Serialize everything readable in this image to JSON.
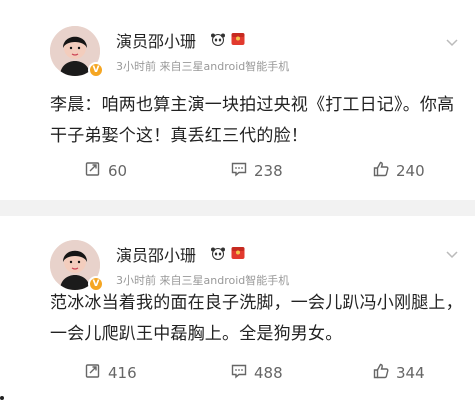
{
  "posts": [
    {
      "username": "演员邵小珊",
      "meta": "3小时前  来自三星android智能手机",
      "content": "李晨：咱两也算主演一块拍过央视《打工日记》。你高干子弟娶个这！真丢红三代的脸！",
      "counts": {
        "repost": "60",
        "comment": "238",
        "like": "240"
      }
    },
    {
      "username": "演员邵小珊",
      "meta": "3小时前  来自三星android智能手机",
      "content": "范冰冰当着我的面在良子洗脚，一会儿趴冯小刚腿上，一会儿爬趴王中磊胸上。全是狗男女。",
      "counts": {
        "repost": "416",
        "comment": "488",
        "like": "344"
      }
    }
  ],
  "icons": {
    "panda": "panda-icon",
    "redpacket": "redpacket-icon",
    "verified": "verified-badge-icon",
    "repost": "repost-icon",
    "comment": "comment-icon",
    "like": "like-icon",
    "chevron": "chevron-down-icon"
  },
  "colors": {
    "text": "#222222",
    "meta": "#999999",
    "action_text": "#666666",
    "verified": "#f5a623",
    "separator": "#f2f2f2"
  }
}
